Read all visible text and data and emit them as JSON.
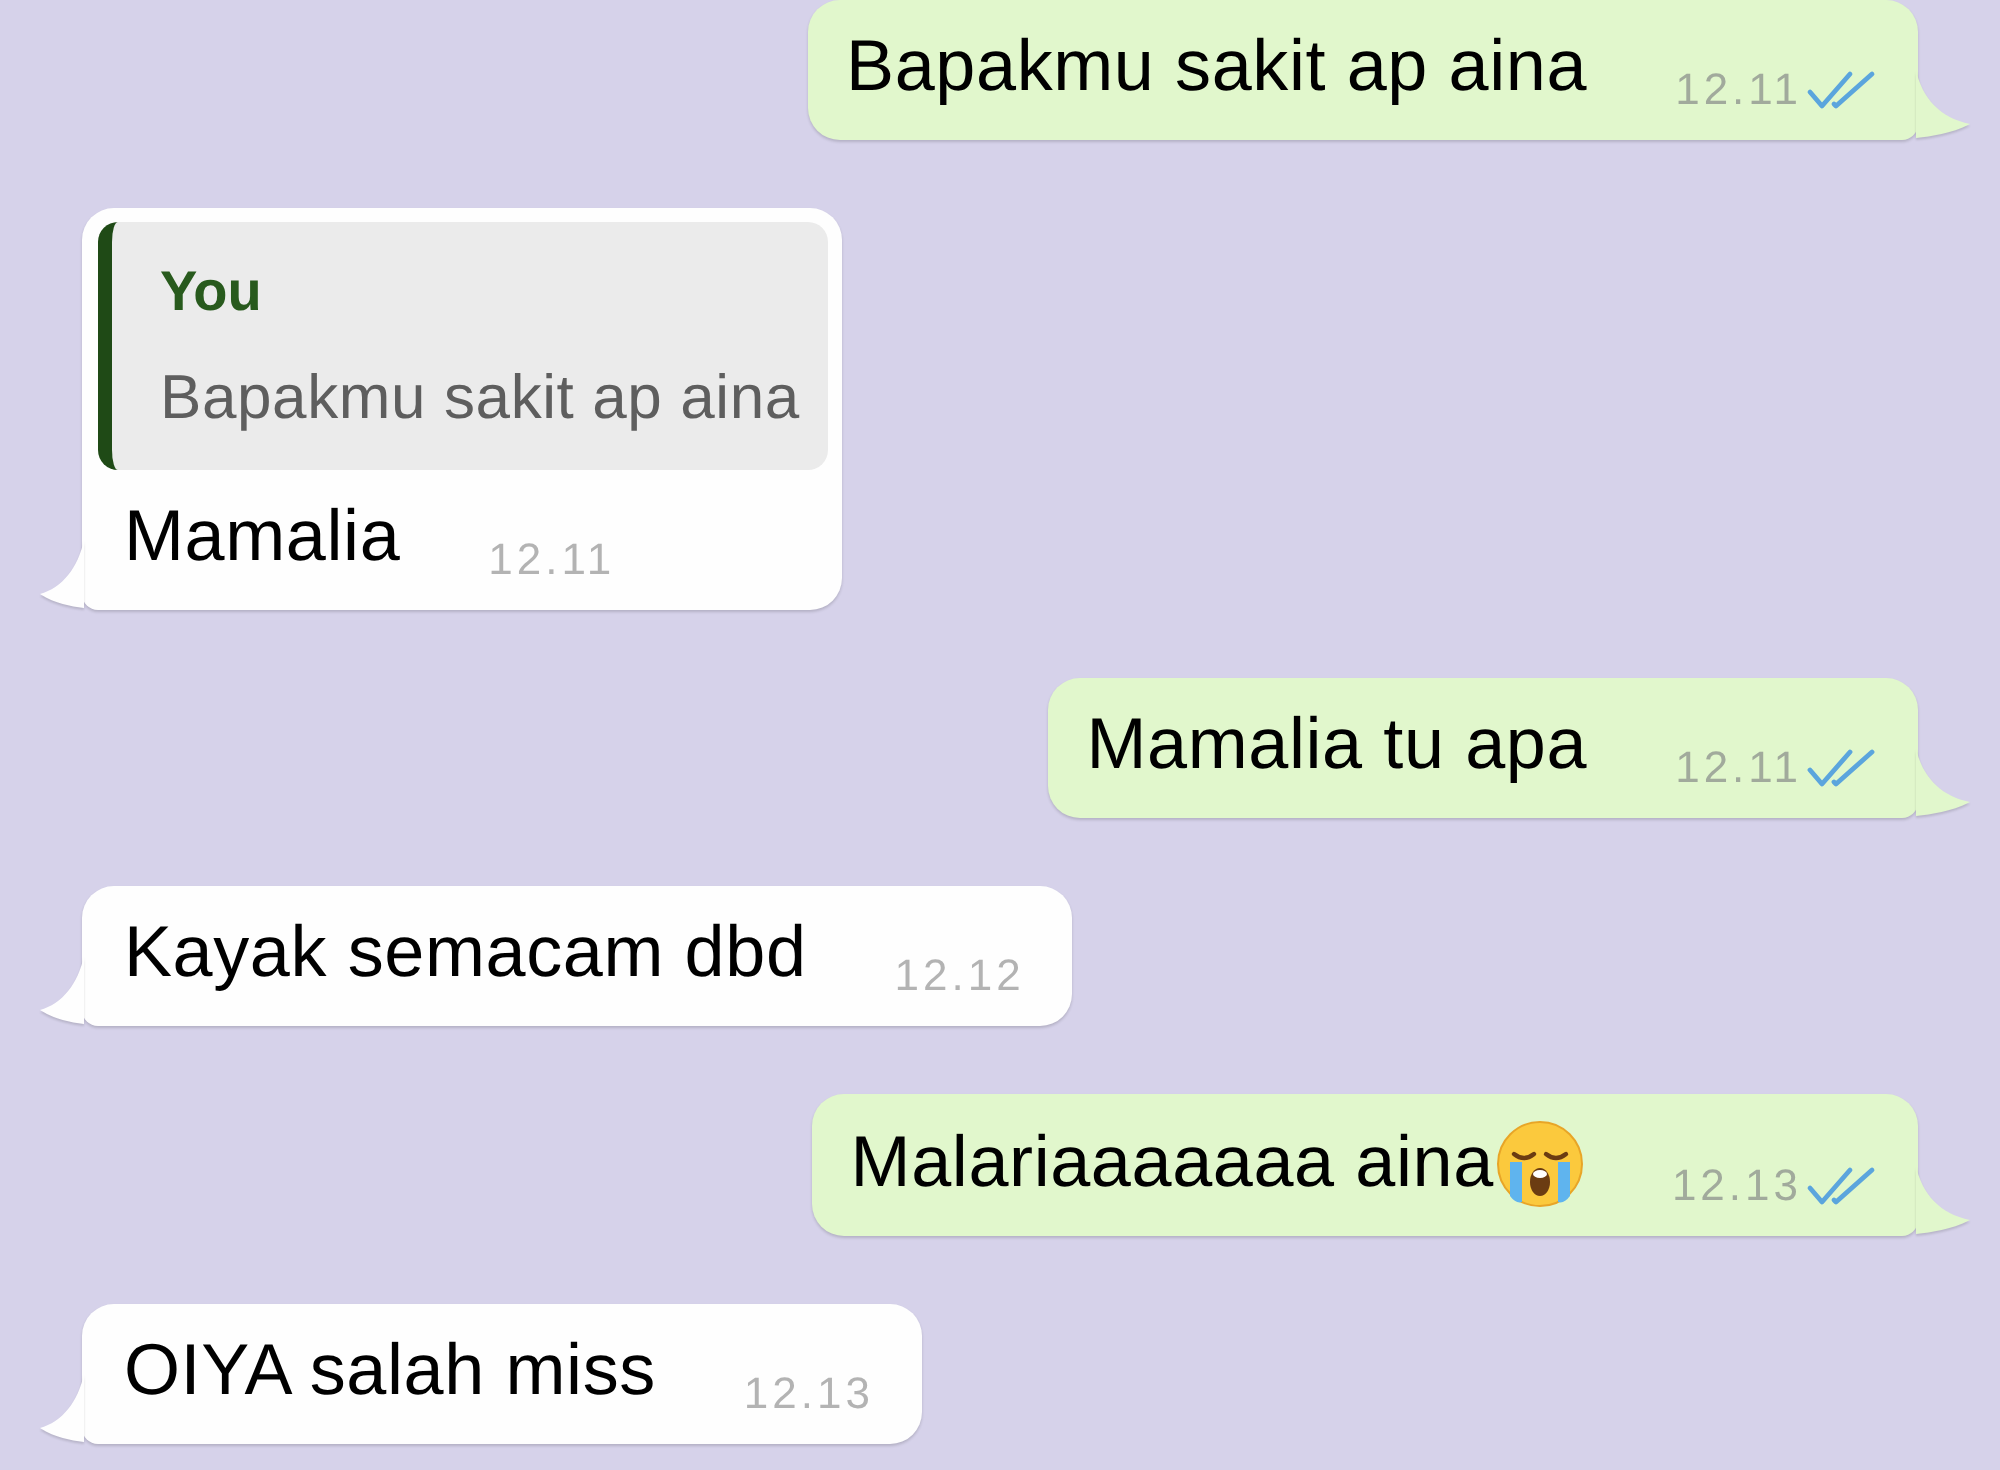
{
  "messages": [
    {
      "kind": "outgoing",
      "text": "Bapakmu sakit ap aina",
      "time": "12.11",
      "read": true,
      "trailing_emoji": false
    },
    {
      "kind": "incoming",
      "reply": {
        "author": "You",
        "text": "Bapakmu sakit ap aina"
      },
      "text": "Mamalia",
      "time": "12.11",
      "trailing_emoji": false
    },
    {
      "kind": "outgoing",
      "text": "Mamalia tu apa",
      "time": "12.11",
      "read": true,
      "trailing_emoji": false
    },
    {
      "kind": "incoming",
      "text": "Kayak semacam dbd",
      "time": "12.12",
      "trailing_emoji": false
    },
    {
      "kind": "outgoing",
      "text": "Malariaaaaaaa aina",
      "time": "12.13",
      "read": true,
      "trailing_emoji": true
    },
    {
      "kind": "incoming",
      "text": "OIYA salah miss",
      "time": "12.13",
      "trailing_emoji": false
    }
  ]
}
